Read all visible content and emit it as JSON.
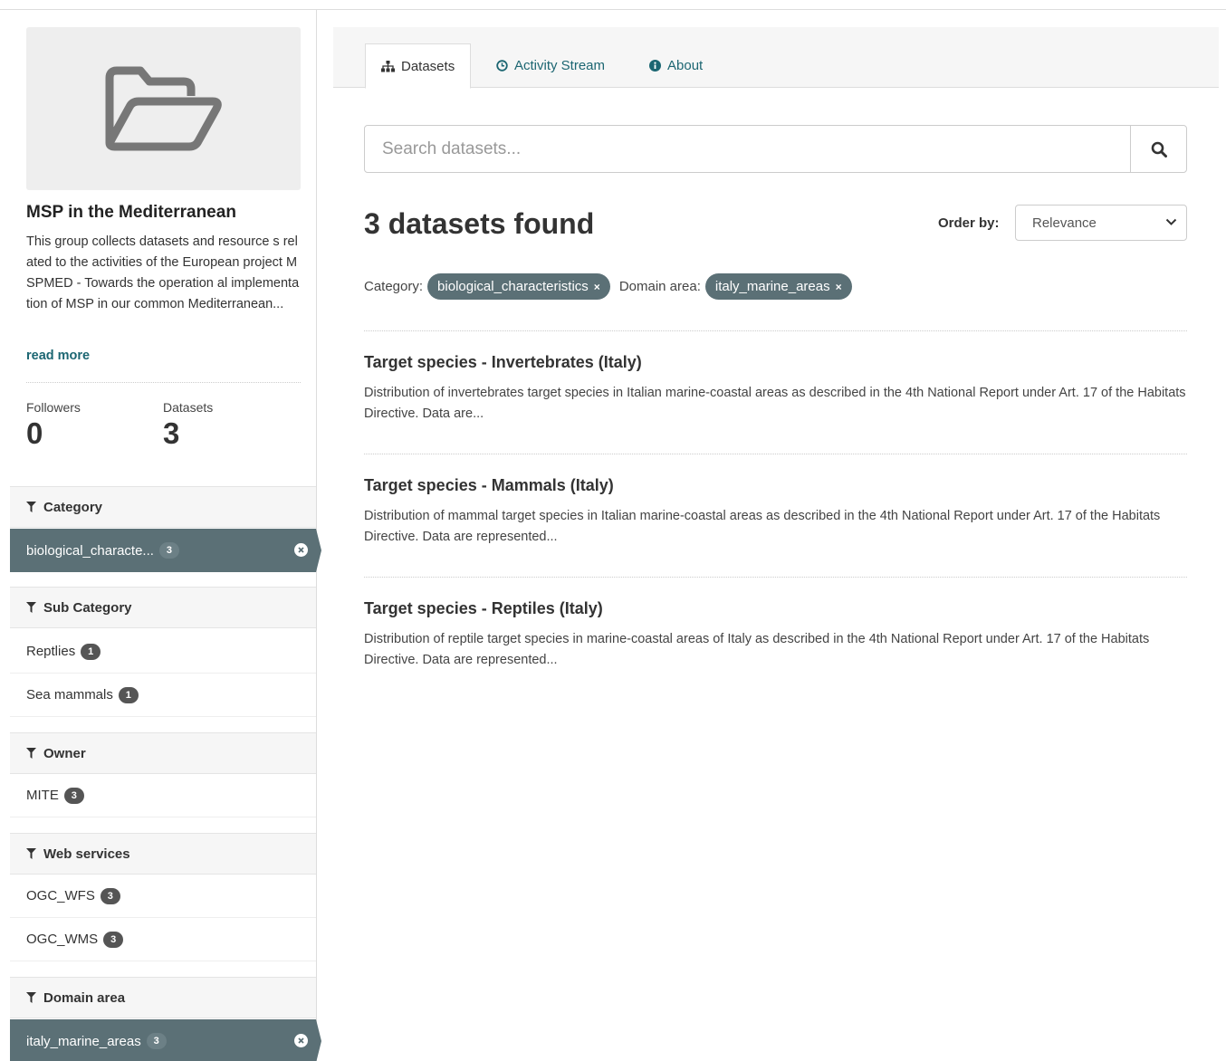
{
  "group": {
    "image_icon": "folder-open-icon",
    "title": "MSP in the Mediterranean",
    "description": "This group collects datasets and resource s related to the activities of the European project MSPMED - Towards the operation al implementation of MSP in our common Mediterranean...",
    "read_more": "read more",
    "followers_label": "Followers",
    "followers_count": "0",
    "datasets_label": "Datasets",
    "datasets_count": "3"
  },
  "facets": {
    "category": {
      "title": "Category",
      "items": [
        {
          "label": "biological_characte...",
          "count": "3",
          "active": true
        }
      ]
    },
    "sub_category": {
      "title": "Sub Category",
      "items": [
        {
          "label": "Reptlies",
          "count": "1"
        },
        {
          "label": "Sea mammals",
          "count": "1"
        }
      ]
    },
    "owner": {
      "title": "Owner",
      "items": [
        {
          "label": "MITE",
          "count": "3"
        }
      ]
    },
    "web_services": {
      "title": "Web services",
      "items": [
        {
          "label": "OGC_WFS",
          "count": "3"
        },
        {
          "label": "OGC_WMS",
          "count": "3"
        }
      ]
    },
    "domain_area": {
      "title": "Domain area",
      "items": [
        {
          "label": "italy_marine_areas",
          "count": "3",
          "active": true
        }
      ]
    }
  },
  "tabs": [
    {
      "label": "Datasets",
      "icon": "sitemap-icon",
      "active": true
    },
    {
      "label": "Activity Stream",
      "icon": "clock-icon"
    },
    {
      "label": "About",
      "icon": "info-icon"
    }
  ],
  "search": {
    "placeholder": "Search datasets...",
    "value": ""
  },
  "results": {
    "found_text": "3 datasets found",
    "order_label": "Order by:",
    "order_value": "Relevance"
  },
  "active_filters": {
    "category_label": "Category:",
    "category_value": "biological_characteristics",
    "domain_label": "Domain area:",
    "domain_value": "italy_marine_areas",
    "remove_glyph": "×"
  },
  "datasets": [
    {
      "title": "Target species - Invertebrates (Italy)",
      "notes": "Distribution of invertebrates target species in Italian marine-coastal areas as described in the 4th National Report under Art. 17 of the Habitats Directive. Data are..."
    },
    {
      "title": "Target species - Mammals (Italy)",
      "notes": "Distribution of mammal target species in Italian marine-coastal areas as described in the 4th National Report under Art. 17 of the Habitats Directive. Data are represented..."
    },
    {
      "title": "Target species - Reptiles (Italy)",
      "notes": "Distribution of reptile target species in marine-coastal areas of Italy as described in the 4th National Report under Art. 17 of the Habitats Directive. Data are represented..."
    }
  ],
  "colors": {
    "accent": "#1c6672",
    "active_facet": "#5b7076",
    "badge": "#555555"
  }
}
